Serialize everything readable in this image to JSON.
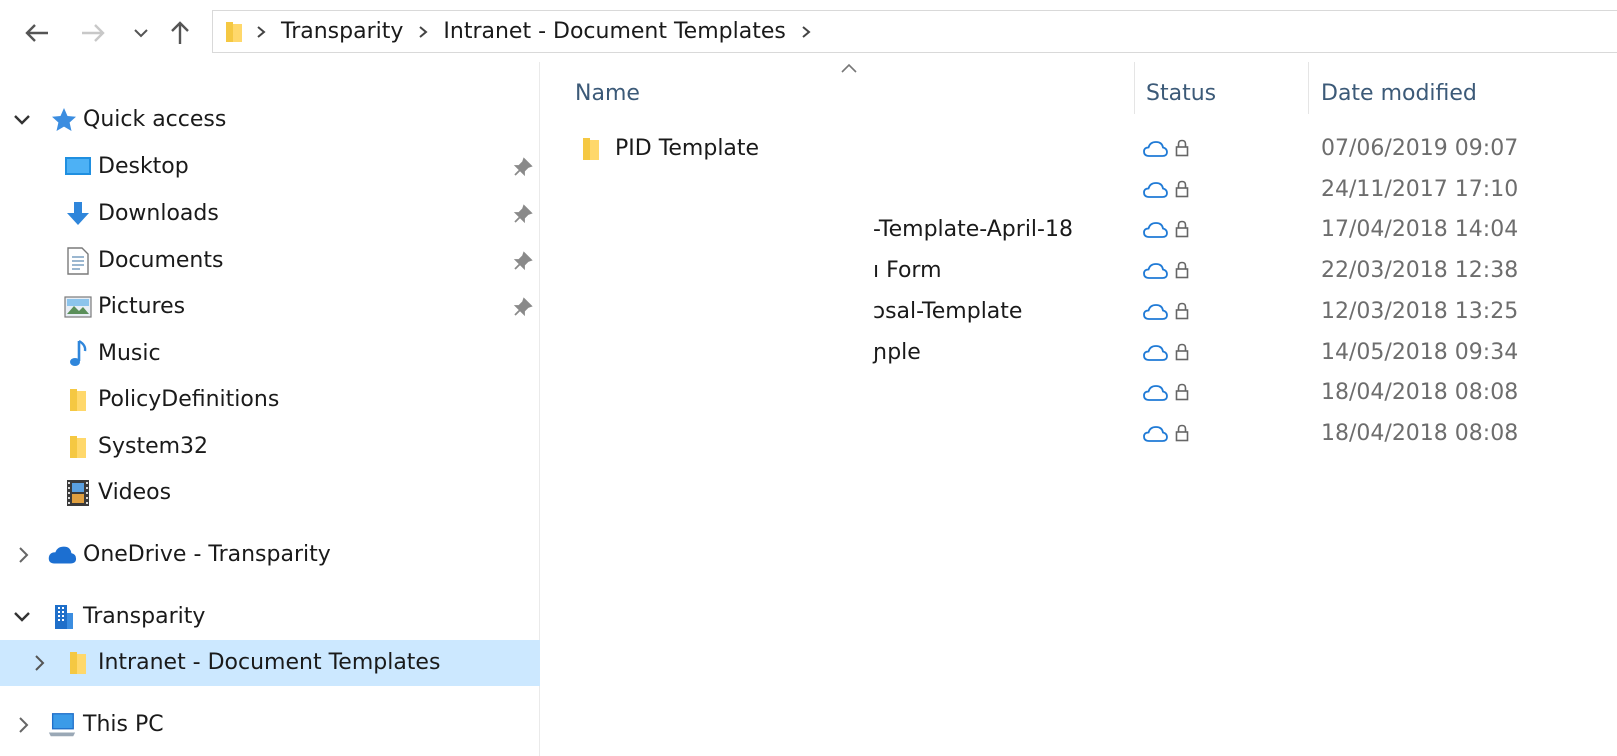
{
  "toolbar": {
    "back_icon": "arrow-left-icon",
    "forward_icon": "arrow-right-icon",
    "recent_icon": "chevron-down-icon",
    "up_icon": "arrow-up-icon"
  },
  "address": {
    "folder_icon": "folder-icon",
    "segments": [
      "Transparity",
      "Intranet - Document Templates"
    ]
  },
  "sidebar": {
    "items": [
      {
        "label": "Quick access",
        "icon": "star-icon",
        "expanded": true
      },
      {
        "label": "Desktop",
        "icon": "desktop-icon",
        "pinned": true
      },
      {
        "label": "Downloads",
        "icon": "download-icon",
        "pinned": true
      },
      {
        "label": "Documents",
        "icon": "document-icon",
        "pinned": true
      },
      {
        "label": "Pictures",
        "icon": "picture-icon",
        "pinned": true
      },
      {
        "label": "Music",
        "icon": "music-note-icon"
      },
      {
        "label": "PolicyDefinitions",
        "icon": "folder-icon"
      },
      {
        "label": "System32",
        "icon": "folder-icon"
      },
      {
        "label": "Videos",
        "icon": "film-icon"
      },
      {
        "label": "OneDrive - Transparity",
        "icon": "cloud-icon",
        "expanded": false
      },
      {
        "label": "Transparity",
        "icon": "building-icon",
        "expanded": true
      },
      {
        "label": "Intranet - Document Templates",
        "icon": "folder-icon",
        "expanded": false,
        "selected": true
      },
      {
        "label": "This PC",
        "icon": "computer-icon",
        "expanded": false
      }
    ]
  },
  "columns": {
    "name": "Name",
    "status": "Status",
    "date_modified": "Date modified"
  },
  "files": [
    {
      "name": "PID Template",
      "is_folder": true,
      "date": "07/06/2019 09:07"
    },
    {
      "name": "",
      "is_folder": false,
      "date": "24/11/2017 17:10"
    },
    {
      "name": "-Template-April-18",
      "is_folder": false,
      "date": "17/04/2018 14:04"
    },
    {
      "name": "ı Form",
      "is_folder": false,
      "date": "22/03/2018 12:38"
    },
    {
      "name": "ɔsal-Template",
      "is_folder": false,
      "date": "12/03/2018 13:25"
    },
    {
      "name": "ɲple",
      "is_folder": false,
      "date": "14/05/2018 09:34"
    },
    {
      "name": "",
      "is_folder": false,
      "date": "18/04/2018 08:08"
    },
    {
      "name": "",
      "is_folder": false,
      "date": "18/04/2018 08:08"
    }
  ],
  "colors": {
    "selected_bg": "#cce8ff",
    "cloud_status": "#1f7ad6",
    "header_text": "#3c5a78",
    "folder_yellow": "#f5c842"
  }
}
